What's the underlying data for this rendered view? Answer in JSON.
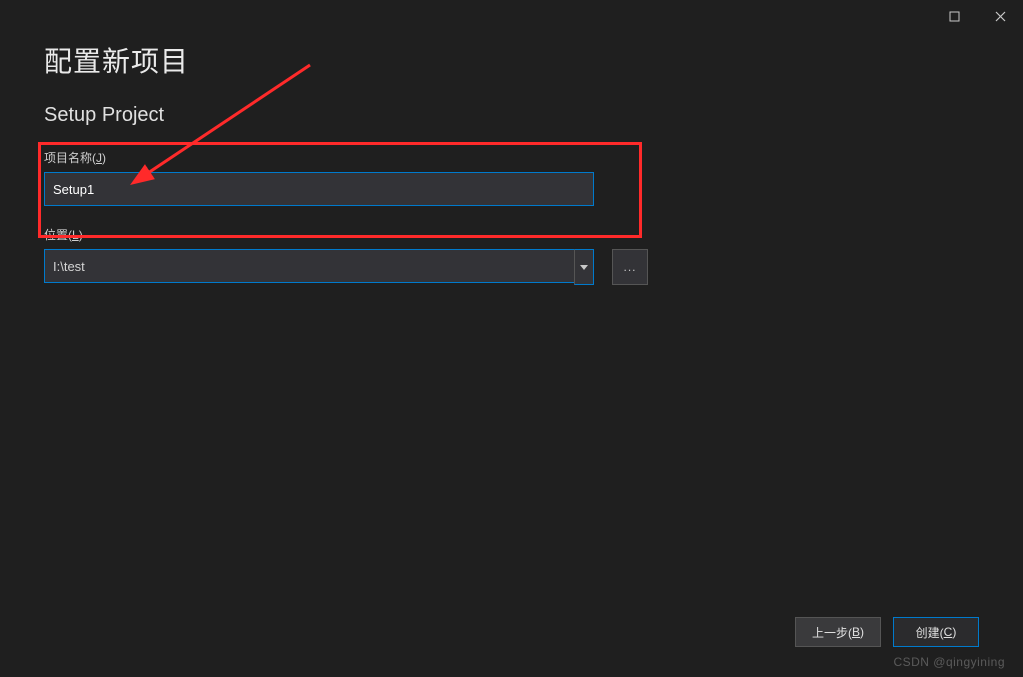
{
  "window": {
    "maximize_title": "Maximize",
    "close_title": "Close"
  },
  "page": {
    "title": "配置新项目",
    "subtitle": "Setup Project"
  },
  "fields": {
    "project_name": {
      "label_prefix": "项目名称(",
      "label_accel": "J",
      "label_suffix": ")",
      "value": "Setup1"
    },
    "location": {
      "label_prefix": "位置(",
      "label_accel": "L",
      "label_suffix": ")",
      "value": "I:\\test",
      "browse_label": "..."
    }
  },
  "footer": {
    "back": {
      "prefix": "上一步(",
      "accel": "B",
      "suffix": ")"
    },
    "create": {
      "prefix": "创建(",
      "accel": "C",
      "suffix": ")"
    }
  },
  "watermark": "CSDN @qingyining"
}
